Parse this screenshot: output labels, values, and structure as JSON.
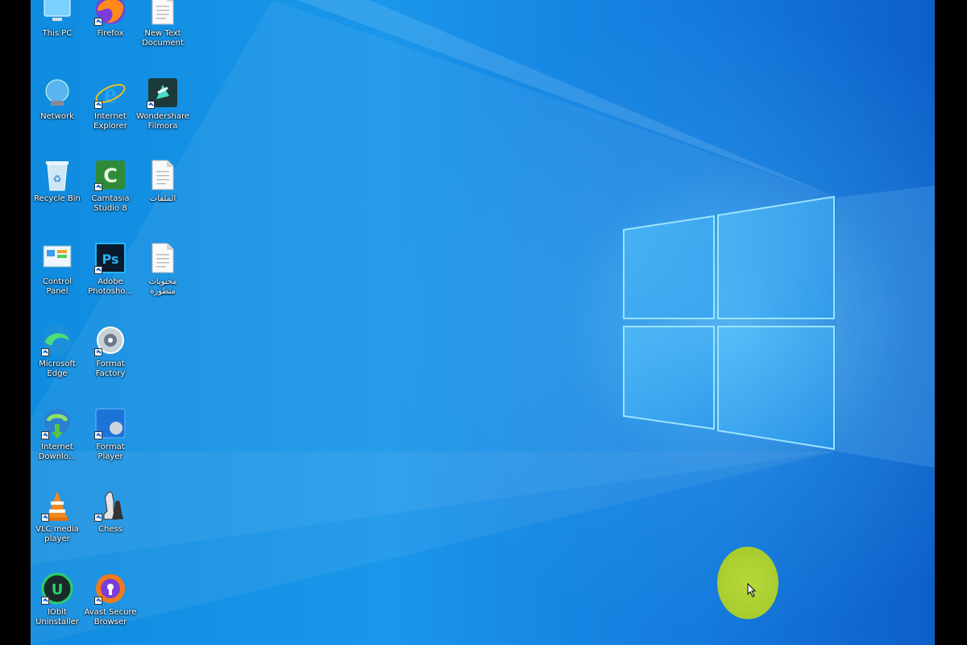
{
  "desktop": {
    "columns": [
      [
        {
          "label": "This PC",
          "icon": "this-pc-icon"
        },
        {
          "label": "Network",
          "icon": "network-icon"
        },
        {
          "label": "Recycle Bin",
          "icon": "recycle-bin-icon"
        },
        {
          "label": "Control\nPanel",
          "icon": "control-panel-icon"
        },
        {
          "label": "Microsoft\nEdge",
          "icon": "edge-icon"
        },
        {
          "label": "Internet\nDownlo...",
          "icon": "idm-icon"
        },
        {
          "label": "VLC media\nplayer",
          "icon": "vlc-icon"
        },
        {
          "label": "IObit\nUninstaller",
          "icon": "iobit-icon"
        }
      ],
      [
        {
          "label": "Firefox",
          "icon": "firefox-icon"
        },
        {
          "label": "Internet\nExplorer",
          "icon": "internet-explorer-icon"
        },
        {
          "label": "Camtasia\nStudio 8",
          "icon": "camtasia-icon"
        },
        {
          "label": "Adobe\nPhotosho...",
          "icon": "photoshop-icon"
        },
        {
          "label": "Format\nFactory",
          "icon": "format-factory-icon"
        },
        {
          "label": "Format\nPlayer",
          "icon": "format-player-icon"
        },
        {
          "label": "Chess",
          "icon": "chess-icon"
        },
        {
          "label": "Avast Secure\nBrowser",
          "icon": "avast-icon"
        }
      ],
      [
        {
          "label": "New Text\nDocument",
          "icon": "text-document-icon"
        },
        {
          "label": "Wondershare\nFilmora",
          "icon": "filmora-icon"
        },
        {
          "label": "الملفات",
          "icon": "text-document-icon"
        },
        {
          "label": "محتويات\nمتطورة",
          "icon": "text-document-icon"
        }
      ]
    ]
  },
  "colors": {
    "wallpaper_left": "#0f8ce0",
    "wallpaper_right": "#0d5fc8",
    "logo_glow": "#7fd8ff",
    "cursor_highlight": "#a8cc2e"
  }
}
